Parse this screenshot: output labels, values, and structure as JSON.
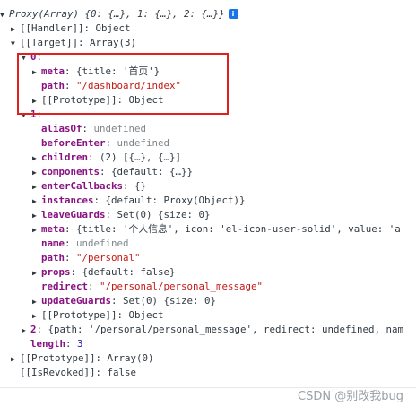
{
  "rows": [
    {
      "tri": "▼",
      "key": "",
      "sep": "",
      "value": "Proxy(Array) {0: {…}, 1: {…}, 2: {…}}",
      "vclass": "obj italic"
    },
    {
      "tri": "▶",
      "key": "[[Handler]]",
      "sep": ": ",
      "value": "Object",
      "vclass": "obj"
    },
    {
      "tri": "▼",
      "key": "[[Target]]",
      "sep": ": ",
      "value": "Array(3)",
      "vclass": "obj"
    },
    {
      "tri": "▼",
      "key": "0",
      "sep": ":",
      "value": "",
      "vclass": "obj"
    },
    {
      "tri": "▶",
      "key": "meta",
      "sep": ": ",
      "value": "{title: '首页'}",
      "vclass": "obj"
    },
    {
      "tri": "",
      "key": "path",
      "sep": ": ",
      "value": "\"/dashboard/index\"",
      "vclass": "str"
    },
    {
      "tri": "▶",
      "key": "[[Prototype]]",
      "sep": ": ",
      "value": "Object",
      "vclass": "obj"
    },
    {
      "tri": "▼",
      "key": "1",
      "sep": ":",
      "value": "",
      "vclass": "obj"
    },
    {
      "tri": "",
      "key": "aliasOf",
      "sep": ": ",
      "value": "undefined",
      "vclass": "undef"
    },
    {
      "tri": "",
      "key": "beforeEnter",
      "sep": ": ",
      "value": "undefined",
      "vclass": "undef"
    },
    {
      "tri": "▶",
      "key": "children",
      "sep": ": ",
      "value": "(2) [{…}, {…}]",
      "vclass": "obj"
    },
    {
      "tri": "▶",
      "key": "components",
      "sep": ": ",
      "value": "{default: {…}}",
      "vclass": "obj"
    },
    {
      "tri": "▶",
      "key": "enterCallbacks",
      "sep": ": ",
      "value": "{}",
      "vclass": "obj"
    },
    {
      "tri": "▶",
      "key": "instances",
      "sep": ": ",
      "value": "{default: Proxy(Object)}",
      "vclass": "obj"
    },
    {
      "tri": "▶",
      "key": "leaveGuards",
      "sep": ": ",
      "value": "Set(0) {size: 0}",
      "vclass": "obj"
    },
    {
      "tri": "▶",
      "key": "meta",
      "sep": ": ",
      "value": "{title: '个人信息', icon: 'el-icon-user-solid', value: 'a",
      "vclass": "obj"
    },
    {
      "tri": "",
      "key": "name",
      "sep": ": ",
      "value": "undefined",
      "vclass": "undef"
    },
    {
      "tri": "",
      "key": "path",
      "sep": ": ",
      "value": "\"/personal\"",
      "vclass": "str"
    },
    {
      "tri": "▶",
      "key": "props",
      "sep": ": ",
      "value": "{default: false}",
      "vclass": "obj"
    },
    {
      "tri": "",
      "key": "redirect",
      "sep": ": ",
      "value": "\"/personal/personal_message\"",
      "vclass": "str"
    },
    {
      "tri": "▶",
      "key": "updateGuards",
      "sep": ": ",
      "value": "Set(0) {size: 0}",
      "vclass": "obj"
    },
    {
      "tri": "▶",
      "key": "[[Prototype]]",
      "sep": ": ",
      "value": "Object",
      "vclass": "obj"
    },
    {
      "tri": "▶",
      "key": "2",
      "sep": ": ",
      "value": "{path: '/personal/personal_message', redirect: undefined, nam",
      "vclass": "obj"
    },
    {
      "tri": "",
      "key": "length",
      "sep": ": ",
      "value": "3",
      "vclass": "num"
    },
    {
      "tri": "▶",
      "key": "[[Prototype]]",
      "sep": ": ",
      "value": "Array(0)",
      "vclass": "obj"
    },
    {
      "tri": "",
      "key": "[[IsRevoked]]",
      "sep": ": ",
      "value": "false",
      "vclass": "obj"
    }
  ],
  "info_icon": "i",
  "watermark": "CSDN @别改我bug"
}
